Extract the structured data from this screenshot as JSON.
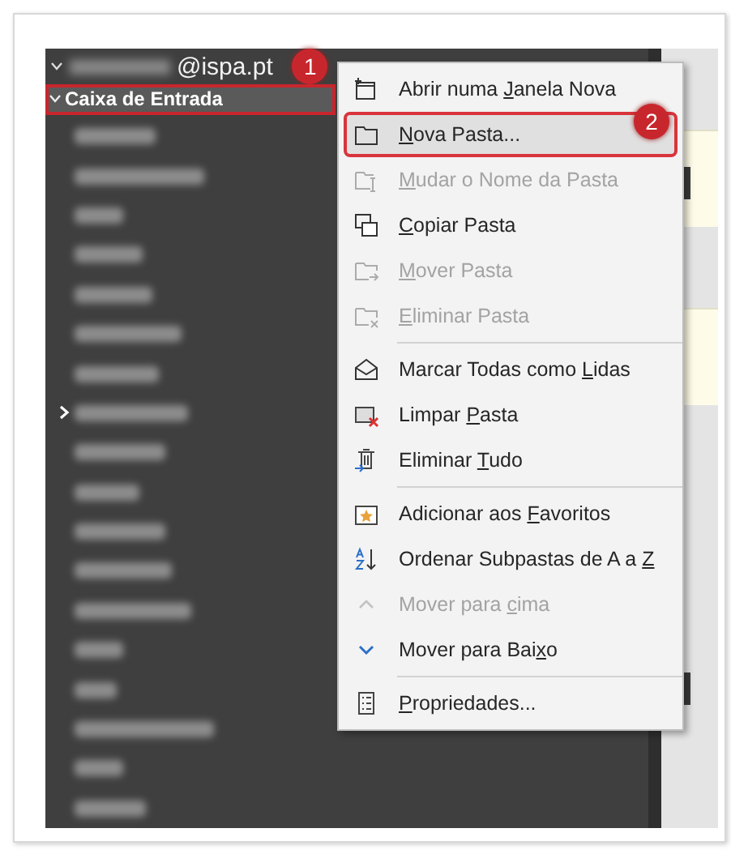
{
  "account": {
    "address": "@ispa.pt",
    "badge": "1"
  },
  "inbox": {
    "label": "Caixa de Entrada",
    "expanded": true,
    "selected": true
  },
  "folders": [
    {
      "has_children": false
    },
    {
      "has_children": false
    },
    {
      "has_children": false
    },
    {
      "has_children": false
    },
    {
      "has_children": false
    },
    {
      "has_children": false
    },
    {
      "has_children": false
    },
    {
      "has_children": true
    },
    {
      "has_children": false
    },
    {
      "has_children": false
    },
    {
      "has_children": false
    },
    {
      "has_children": false
    },
    {
      "has_children": false
    },
    {
      "has_children": false
    },
    {
      "has_children": false
    },
    {
      "has_children": false
    },
    {
      "has_children": false
    },
    {
      "has_children": false
    }
  ],
  "context_menu": {
    "badge": "2",
    "items": [
      {
        "kind": "item",
        "before": "Abrir numa ",
        "key": "J",
        "after": "anela Nova",
        "disabled": false,
        "selected": false
      },
      {
        "kind": "item",
        "key": "N",
        "after": "ova Pasta...",
        "disabled": false,
        "selected": true
      },
      {
        "kind": "item",
        "key": "M",
        "after": "udar o Nome da Pasta",
        "disabled": true,
        "selected": false
      },
      {
        "kind": "item",
        "key": "C",
        "after": "opiar Pasta",
        "disabled": false,
        "selected": false
      },
      {
        "kind": "item",
        "key": "M",
        "after": "over Pasta",
        "disabled": true,
        "selected": false
      },
      {
        "kind": "item",
        "key": "E",
        "after": "liminar Pasta",
        "disabled": true,
        "selected": false
      },
      {
        "kind": "separator"
      },
      {
        "kind": "item",
        "before": "Marcar Todas como ",
        "key": "L",
        "after": "idas",
        "disabled": false,
        "selected": false
      },
      {
        "kind": "item",
        "before": "Limpar ",
        "key": "P",
        "after": "asta",
        "disabled": false,
        "selected": false
      },
      {
        "kind": "item",
        "before": "Eliminar ",
        "key": "T",
        "after": "udo",
        "disabled": false,
        "selected": false
      },
      {
        "kind": "separator"
      },
      {
        "kind": "item",
        "before": "Adicionar aos ",
        "key": "F",
        "after": "avoritos",
        "disabled": false,
        "selected": false
      },
      {
        "kind": "item",
        "before": "Ordenar Subpastas de A a ",
        "key": "Z",
        "disabled": false,
        "selected": false
      },
      {
        "kind": "item",
        "before": "Mover para ",
        "key": "c",
        "after": "ima",
        "disabled": true,
        "selected": false
      },
      {
        "kind": "item",
        "before": "Mover para Bai",
        "key": "x",
        "after": "o",
        "disabled": false,
        "selected": false
      },
      {
        "kind": "separator"
      },
      {
        "kind": "item",
        "key": "P",
        "after": "ropriedades...",
        "disabled": false,
        "selected": false
      }
    ]
  }
}
